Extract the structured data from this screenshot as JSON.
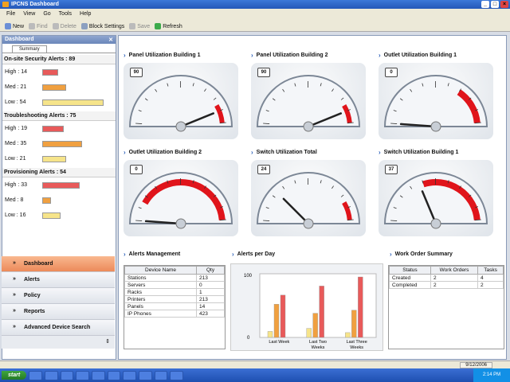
{
  "window": {
    "title": "IPCNS Dashboard"
  },
  "menu": [
    "File",
    "View",
    "Go",
    "Tools",
    "Help"
  ],
  "toolbar": {
    "new": "New",
    "find": "Find",
    "delete": "Delete",
    "block_settings": "Block Settings",
    "save": "Save",
    "refresh": "Refresh"
  },
  "sidebar": {
    "title": "Dashboard",
    "tab": "Summary",
    "groups": [
      {
        "title": "On-site Security Alerts : 89",
        "rows": [
          {
            "label": "High : 14",
            "value": 14,
            "color": "#e85a5a"
          },
          {
            "label": "Med : 21",
            "value": 21,
            "color": "#f0a040"
          },
          {
            "label": "Low : 54",
            "value": 54,
            "color": "#f6e48a"
          }
        ]
      },
      {
        "title": "Troubleshooting Alerts : 75",
        "rows": [
          {
            "label": "High : 19",
            "value": 19,
            "color": "#e85a5a"
          },
          {
            "label": "Med : 35",
            "value": 35,
            "color": "#f0a040"
          },
          {
            "label": "Low : 21",
            "value": 21,
            "color": "#f6e48a"
          }
        ]
      },
      {
        "title": "Provisioning Alerts : 54",
        "rows": [
          {
            "label": "High : 33",
            "value": 33,
            "color": "#e85a5a"
          },
          {
            "label": "Med : 8",
            "value": 8,
            "color": "#f0a040"
          },
          {
            "label": "Low : 16",
            "value": 16,
            "color": "#f6e48a"
          }
        ]
      }
    ],
    "scale_max": 60
  },
  "nav": [
    "Dashboard",
    "Alerts",
    "Policy",
    "Reports",
    "Advanced Device Search"
  ],
  "gauges": [
    {
      "title": "Panel Utilization Building 1",
      "value": 90,
      "red_start": 85,
      "red_thick": false
    },
    {
      "title": "Panel Utilization Building 2",
      "value": 90,
      "red_start": 85,
      "red_thick": false
    },
    {
      "title": "Outlet Utilization Building 1",
      "value": 0,
      "red_start": 70,
      "red_thick": true
    },
    {
      "title": "Outlet Utilization Building 2",
      "value": 0,
      "red_start": 15,
      "red_thick": true
    },
    {
      "title": "Switch Utilization Total",
      "value": 24,
      "red_start": 85,
      "red_thick": false
    },
    {
      "title": "Switch Utilization Building 1",
      "value": 37,
      "red_start": 40,
      "red_thick": true
    }
  ],
  "alerts_management": {
    "title": "Alerts Management",
    "headers": [
      "Device Name",
      "Qty"
    ],
    "rows": [
      [
        "Stations",
        "213"
      ],
      [
        "Servers",
        "0"
      ],
      [
        "Racks",
        "1"
      ],
      [
        "Printers",
        "213"
      ],
      [
        "Panels",
        "14"
      ],
      [
        "IP Phones",
        "423"
      ]
    ]
  },
  "alerts_per_day": {
    "title": "Alerts per Day",
    "chart_data": {
      "type": "bar",
      "categories": [
        "Last Week",
        "Last Two Weeks",
        "Last Three Weeks"
      ],
      "series": [
        {
          "color": "#f6e48a",
          "values": [
            10,
            15,
            8
          ]
        },
        {
          "color": "#f0a040",
          "values": [
            55,
            40,
            45
          ]
        },
        {
          "color": "#e85a5a",
          "values": [
            70,
            85,
            100
          ]
        }
      ],
      "ylim": [
        0,
        100
      ],
      "yticks": [
        "100",
        "0"
      ]
    }
  },
  "work_order": {
    "title": "Work Order Summary",
    "headers": [
      "Status",
      "Work Orders",
      "Tasks"
    ],
    "rows": [
      [
        "Created",
        "2",
        "4"
      ],
      [
        "Completed",
        "2",
        "2"
      ]
    ]
  },
  "status": {
    "date": "9/12/2006"
  },
  "taskbar": {
    "start": "start",
    "tasks": [
      "",
      "",
      "",
      "",
      "",
      "",
      "",
      "",
      "",
      ""
    ],
    "clock": "2:14 PM"
  }
}
